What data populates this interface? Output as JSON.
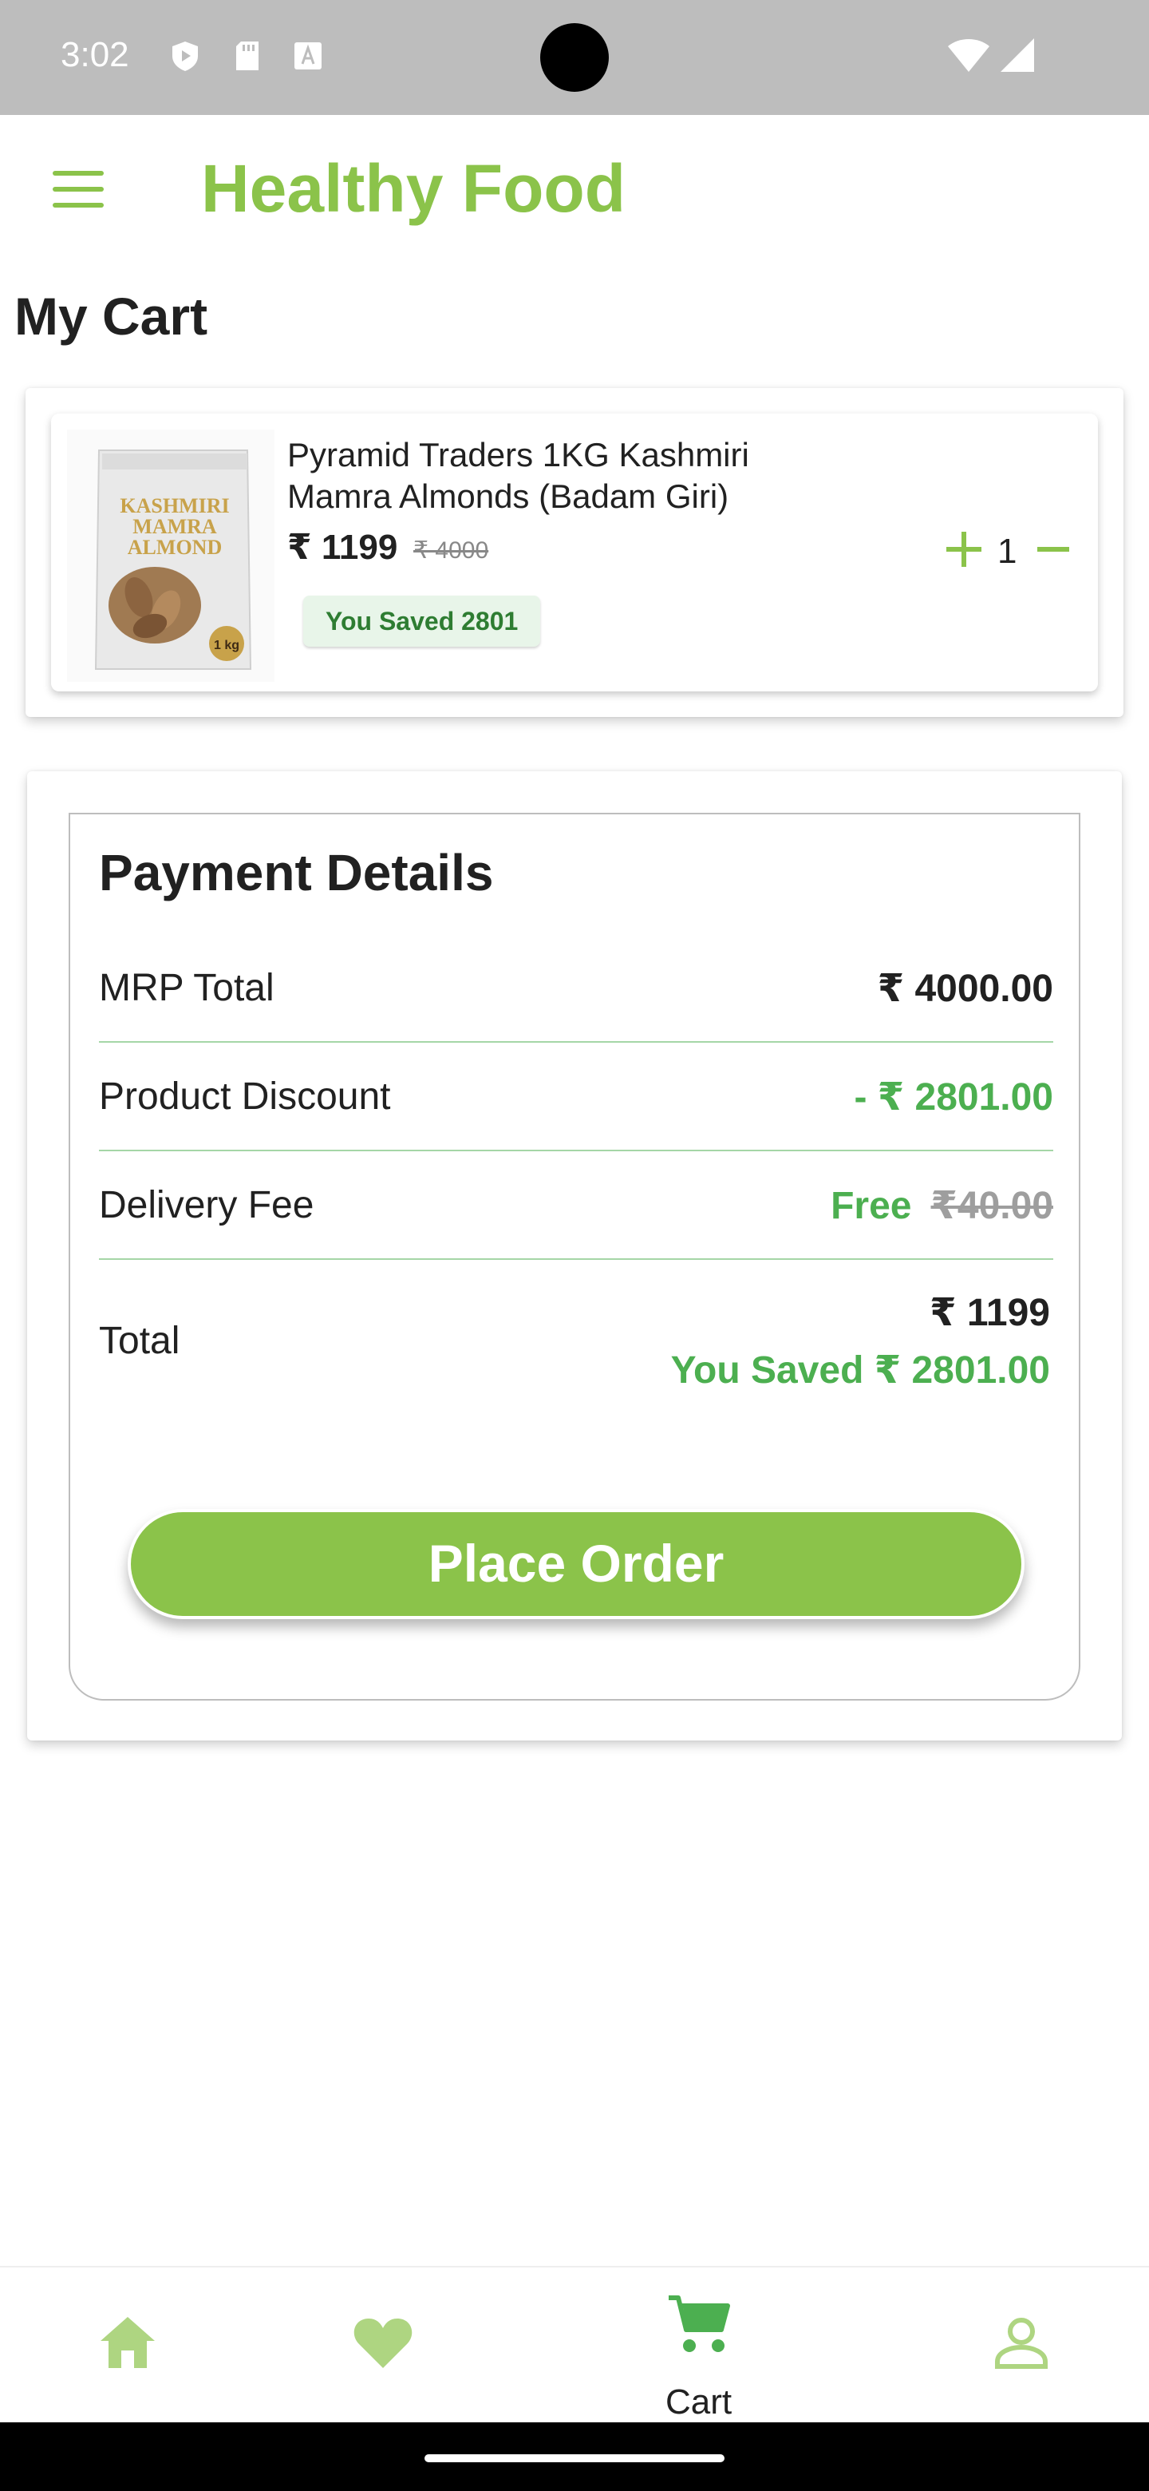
{
  "status_bar": {
    "time": "3:02"
  },
  "app_bar": {
    "title": "Healthy Food",
    "menu_icon": "hamburger-menu-icon"
  },
  "page": {
    "title": "My Cart"
  },
  "cart": {
    "items": [
      {
        "name": "Pyramid Traders 1KG Kashmiri Mamra Almonds (Badam Giri)",
        "price": "₹ 1199",
        "mrp": "₹ 4000",
        "saved": "You Saved 2801",
        "quantity": "1",
        "image_text": [
          "KASHMIRI",
          "MAMRA",
          "ALMOND",
          "1 kg"
        ]
      }
    ]
  },
  "payment": {
    "title": "Payment Details",
    "mrp_total_label": "MRP Total",
    "mrp_total_value": "₹ 4000.00",
    "discount_label": "Product Discount",
    "discount_value": "- ₹ 2801.00",
    "delivery_label": "Delivery Fee",
    "delivery_value": "Free",
    "delivery_old_value": "₹40.00",
    "total_label": "Total",
    "total_value": "₹ 1199",
    "total_saved": "You Saved ₹ 2801.00",
    "place_order_label": "Place Order"
  },
  "bottom_nav": {
    "items": [
      {
        "icon": "home-icon",
        "label": ""
      },
      {
        "icon": "heart-icon",
        "label": ""
      },
      {
        "icon": "cart-icon",
        "label": "Cart",
        "active": true
      },
      {
        "icon": "profile-icon",
        "label": ""
      }
    ]
  },
  "colors": {
    "accent": "#8bc34a",
    "saved_green": "#4caf50",
    "status_bar": "#bdbdbd"
  }
}
